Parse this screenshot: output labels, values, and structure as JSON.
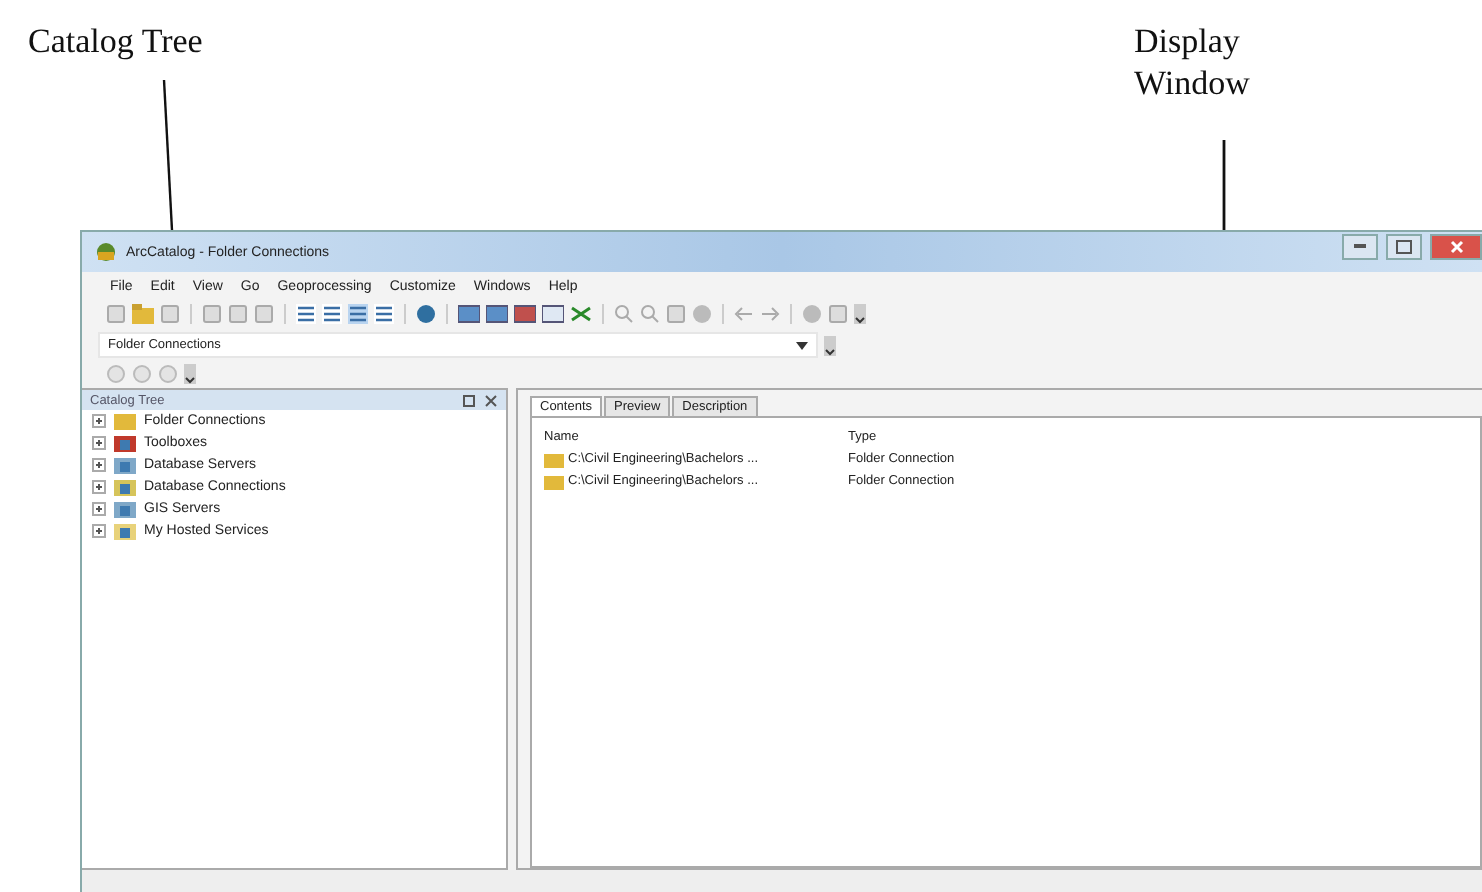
{
  "annotations": [
    {
      "kind": "left",
      "lines": [
        "Catalog Tree"
      ]
    },
    {
      "kind": "right",
      "lines": [
        "Display",
        "Window"
      ]
    }
  ],
  "window": {
    "title": "ArcCatalog - Folder Connections"
  },
  "menu": [
    "File",
    "Edit",
    "View",
    "Go",
    "Geoprocessing",
    "Customize",
    "Windows",
    "Help"
  ],
  "location": {
    "value": "Folder Connections"
  },
  "catalog_tree": {
    "title": "Catalog Tree",
    "items": [
      {
        "label": "Folder Connections",
        "expanded": false,
        "kind": "folder"
      },
      {
        "label": "Toolboxes",
        "expanded": false,
        "kind": "toolbox"
      },
      {
        "label": "Database Servers",
        "expanded": false,
        "kind": "server"
      },
      {
        "label": "Database Connections",
        "expanded": false,
        "kind": "database"
      },
      {
        "label": "GIS Servers",
        "expanded": false,
        "kind": "server"
      },
      {
        "label": "My Hosted Services",
        "expanded": false,
        "kind": "hosted"
      }
    ]
  },
  "tabs": [
    {
      "label": "Contents",
      "selected": true
    },
    {
      "label": "Preview",
      "selected": false
    },
    {
      "label": "Description",
      "selected": false
    }
  ],
  "table": {
    "columns": [
      "Name",
      "Type"
    ],
    "rows": [
      [
        "C:\\Civil Engineering\\Bachelors ...",
        "Folder Connection"
      ],
      [
        "C:\\Civil Engineering\\Bachelors ...",
        "Folder Connection"
      ]
    ]
  }
}
